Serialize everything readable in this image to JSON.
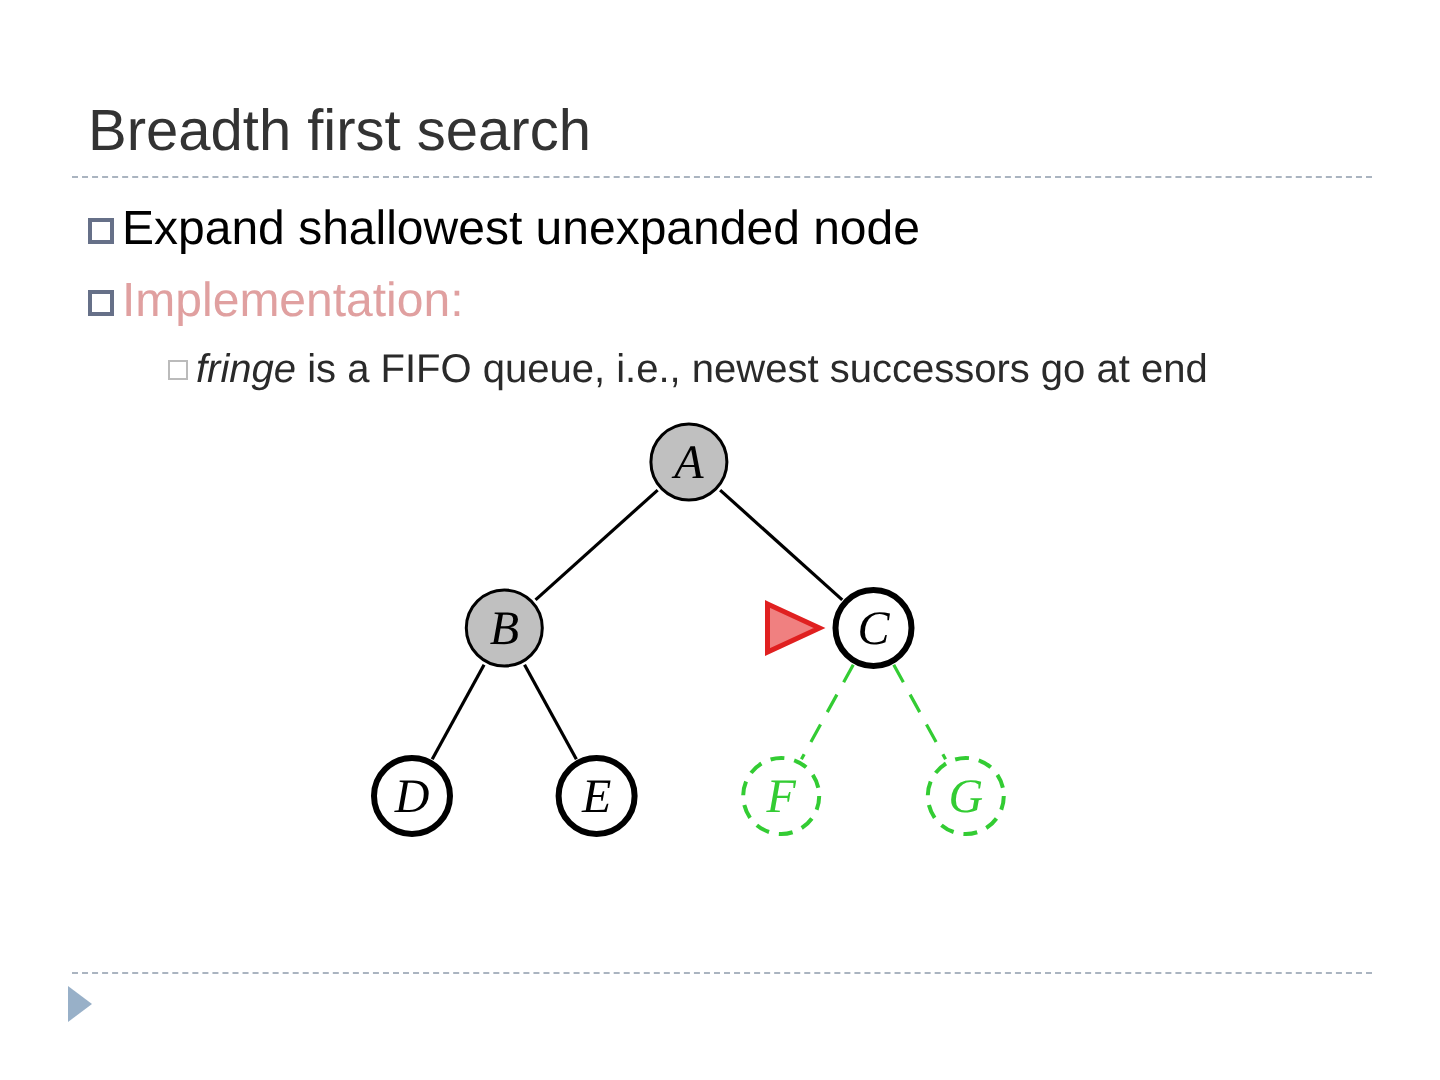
{
  "title": "Breadth first search",
  "bullets": [
    {
      "text": "Expand shallowest unexpanded node",
      "kind": "main"
    },
    {
      "text": "Implementation:",
      "kind": "heading",
      "children": [
        {
          "text": "*fringe* is a FIFO queue, i.e., newest successors go at end",
          "kind": "sub"
        }
      ]
    }
  ],
  "tree": {
    "label": "A",
    "kind": "expanded",
    "pointed": false,
    "children": [
      {
        "label": "B",
        "kind": "expanded",
        "pointed": false,
        "children": [
          {
            "label": "D",
            "kind": "fringe",
            "pointed": false
          },
          {
            "label": "E",
            "kind": "fringe",
            "pointed": false
          }
        ]
      },
      {
        "label": "C",
        "kind": "fringe",
        "pointed": true,
        "children": [
          {
            "label": "F",
            "kind": "unseen",
            "pointed": false
          },
          {
            "label": "G",
            "kind": "unseen",
            "pointed": false
          }
        ]
      }
    ]
  }
}
